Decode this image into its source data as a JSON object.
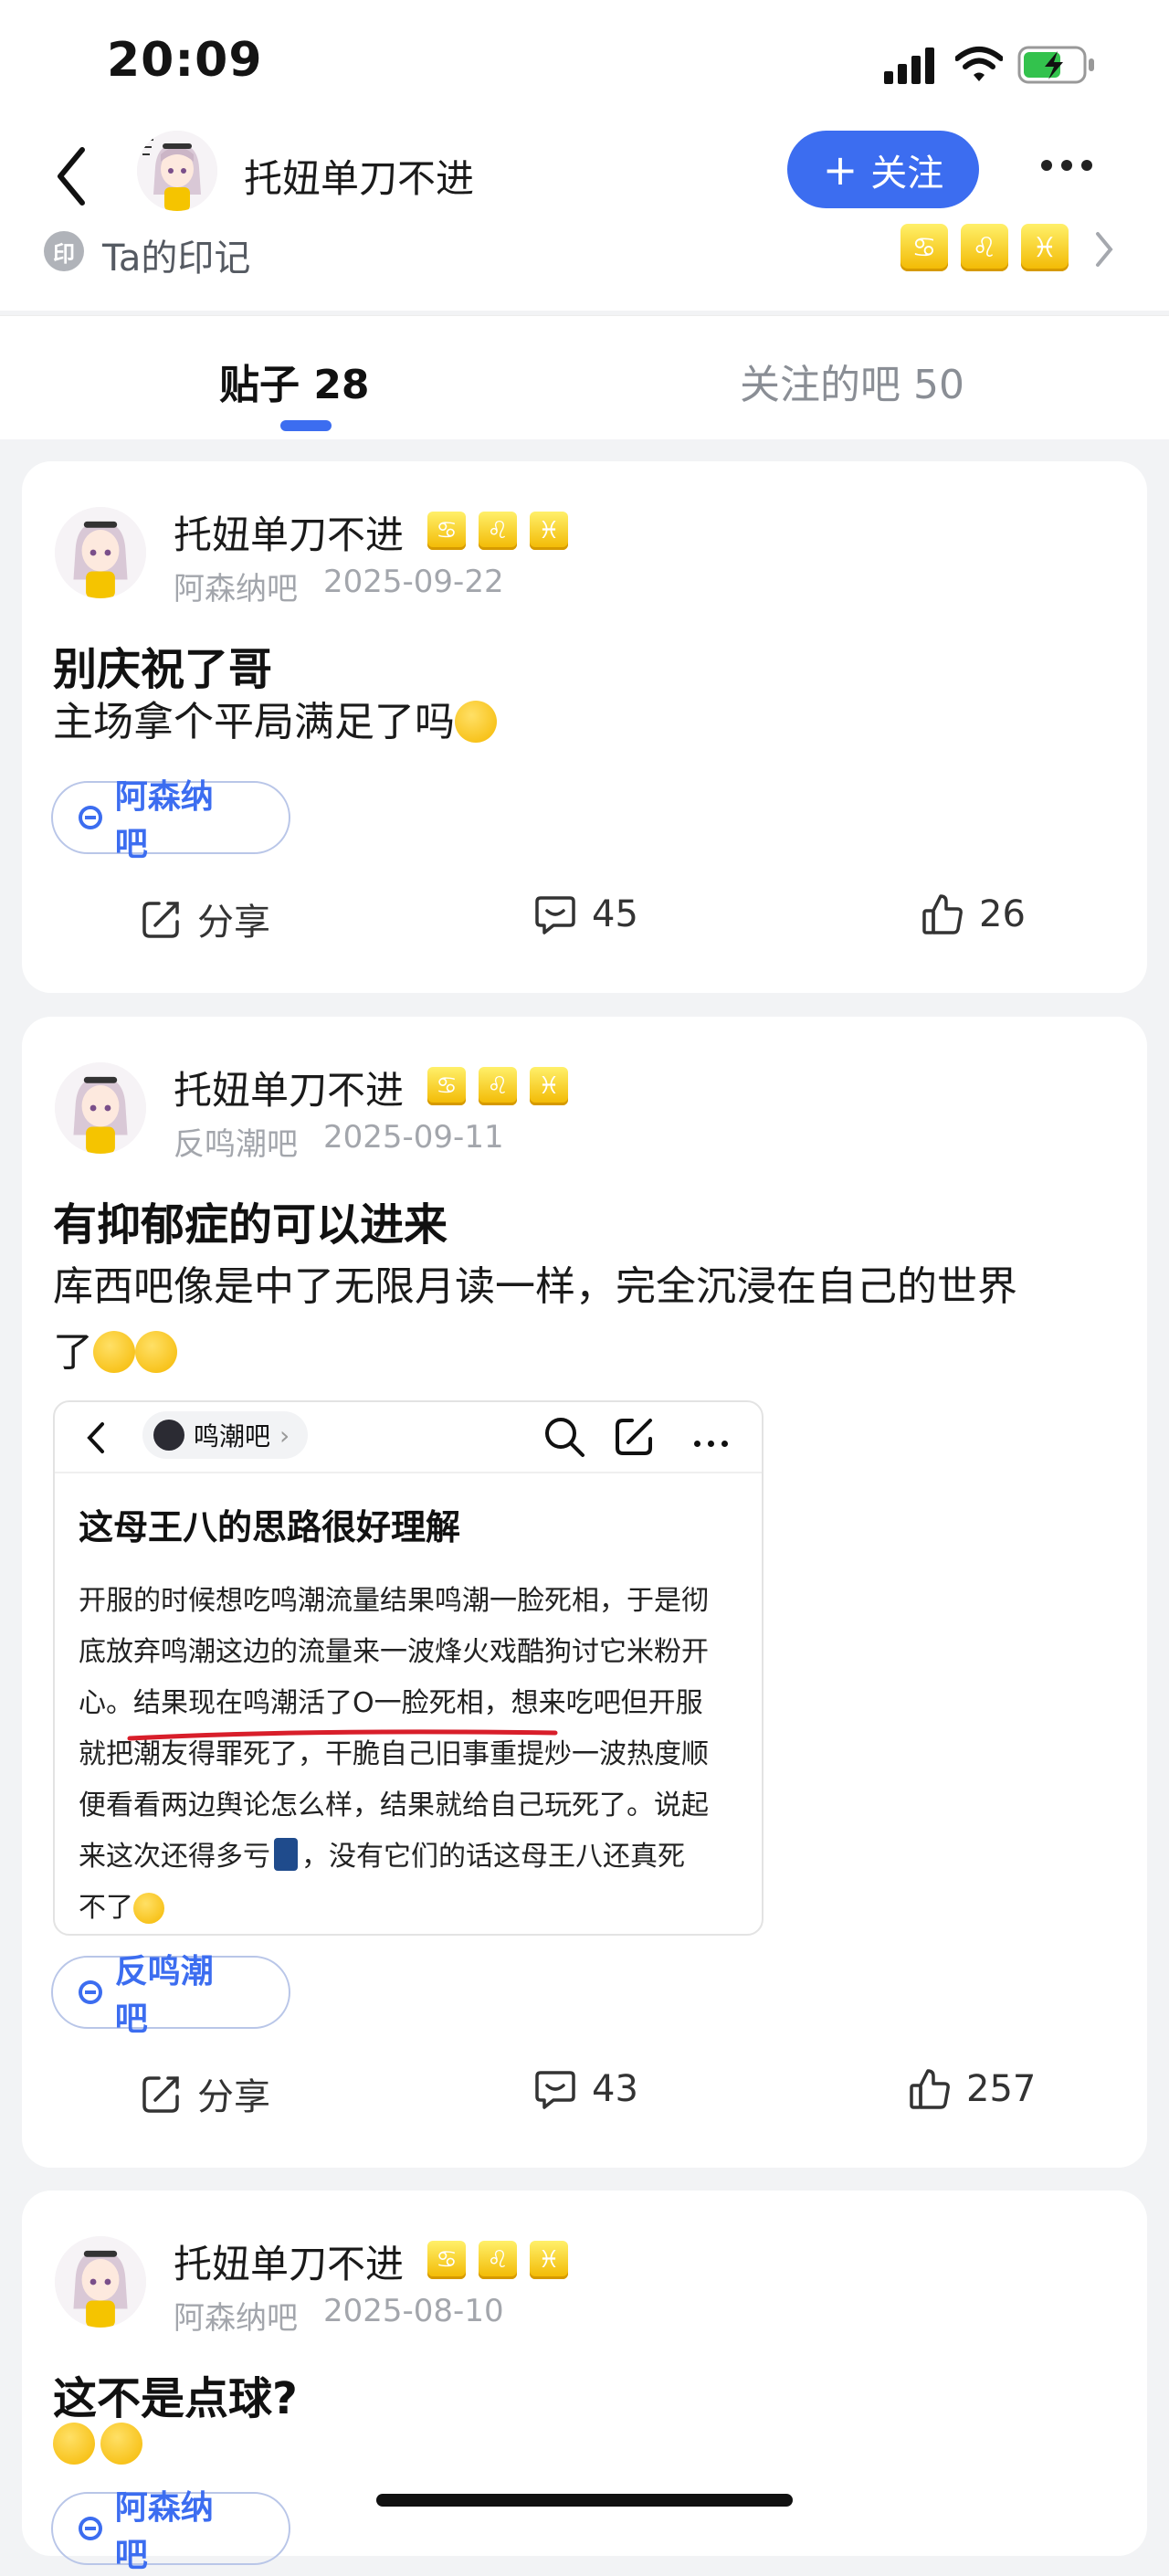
{
  "status_bar": {
    "time": "20:09"
  },
  "header": {
    "username": "托妞单刀不进",
    "follow_label": "关注",
    "mark_icon": "印",
    "mark_label": "Ta的印记",
    "zodiac_icons": [
      "♋",
      "♌",
      "♓"
    ]
  },
  "tabs": [
    {
      "label": "贴子 28",
      "active": true
    },
    {
      "label": "关注的吧 50",
      "active": false
    }
  ],
  "share_label": "分享",
  "posts": [
    {
      "author": "托妞单刀不进",
      "forum": "阿森纳吧",
      "date": "2025-09-22",
      "title": "别庆祝了哥",
      "body": "主场拿个平局满足了吗",
      "tag": "阿森纳吧",
      "comments": "45",
      "likes": "26"
    },
    {
      "author": "托妞单刀不进",
      "forum": "反鸣潮吧",
      "date": "2025-09-11",
      "title": "有抑郁症的可以进来",
      "body_line1": "库西吧像是中了无限月读一样，完全沉浸在自己的世界",
      "body_line2": "了",
      "embedded": {
        "forum": "鸣潮吧",
        "title": "这母王八的思路很好理解",
        "lines": [
          "开服的时候想吃鸣潮流量结果鸣潮一脸死相，于是彻",
          "底放弃鸣潮这边的流量来一波烽火戏酷狗讨它米粉开",
          "心。结果现在鸣潮活了O一脸死相，想来吃吧但开服",
          "就把潮友得罪死了，干脆自己旧事重提炒一波热度顺",
          "便看看两边舆论怎么样，结果就给自己玩死了。说起",
          "来这次还得多亏",
          "，没有它们的话这母王八还真死",
          "不了"
        ]
      },
      "tag": "反鸣潮吧",
      "comments": "43",
      "likes": "257"
    },
    {
      "author": "托妞单刀不进",
      "forum": "阿森纳吧",
      "date": "2025-08-10",
      "title": "这不是点球?",
      "tag": "阿森纳吧"
    }
  ],
  "colors": {
    "accent": "#3c6df0",
    "zodiac": "#f2b800"
  }
}
